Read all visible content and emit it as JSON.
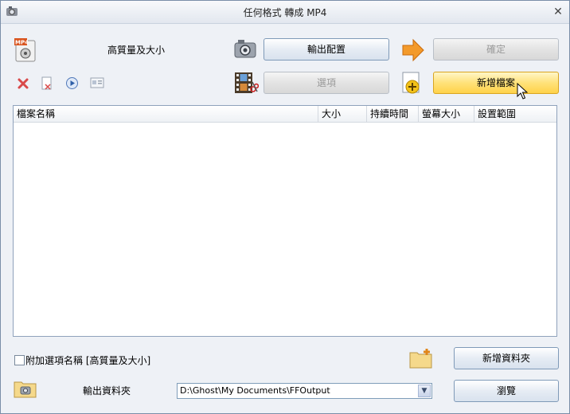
{
  "window": {
    "title": "任何格式 轉成 MP4"
  },
  "top": {
    "quality_label": "高質量及大小",
    "output_config_label": "輸出配置",
    "confirm_label": "確定",
    "options_label": "選項",
    "add_file_label": "新增檔案",
    "format_badge": "MP4"
  },
  "list": {
    "columns": [
      "檔案名稱",
      "大小",
      "持續時間",
      "螢幕大小",
      "設置範圍"
    ]
  },
  "bottom": {
    "append_option_label": "附加選項名稱 [高質量及大小]",
    "add_folder_label": "新增資料夾",
    "output_folder_label": "輸出資料夾",
    "output_path": "D:\\Ghost\\My Documents\\FFOutput",
    "browse_label": "瀏覽"
  },
  "colors": {
    "accent": "#ffd24a",
    "border": "#7f9ab8"
  }
}
